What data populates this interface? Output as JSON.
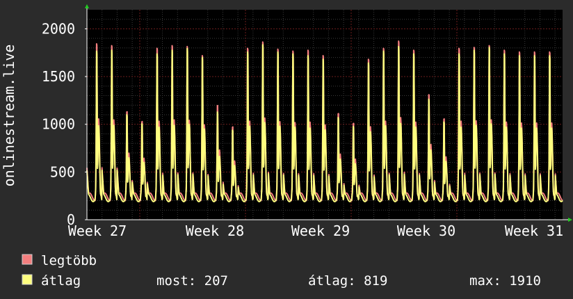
{
  "chart_data": {
    "type": "line",
    "ylabel": "onlinestream.live",
    "ylim": [
      0,
      2200
    ],
    "y_ticks": [
      "0",
      "500",
      "1000",
      "1500",
      "2000"
    ],
    "y_tick_values": [
      0,
      500,
      1000,
      1500,
      2000
    ],
    "x_ticks": [
      "Week 27",
      "Week 28",
      "Week 29",
      "Week 30",
      "Week 31"
    ],
    "x_range_days": 31.5,
    "x_tick_days": [
      0,
      7,
      14,
      21,
      28
    ],
    "grid": true,
    "colors": {
      "background": "#2b2b2b",
      "plot": "#000000",
      "grid_minor": "#3a3a3a",
      "grid_major": "#6b1d1d",
      "axis": "#ffffff",
      "arrow": "#22cc22"
    },
    "series": [
      {
        "name": "legtöbb",
        "color": "#f47f7f",
        "daily_peaks": [
          1930,
          1910,
          1180,
          1070,
          1880,
          1910,
          1900,
          1800,
          1250,
          1010,
          1880,
          1950,
          1870,
          1850,
          1860,
          1800,
          1160,
          1050,
          1760,
          1880,
          1960,
          1860,
          1370,
          1100,
          1880,
          1890,
          1910,
          1860,
          1840
        ],
        "trough": 240
      },
      {
        "name": "átlag",
        "color": "#fefe7f",
        "daily_peaks": [
          1830,
          1840,
          1130,
          1030,
          1800,
          1840,
          1860,
          1760,
          1160,
          960,
          1820,
          1900,
          1820,
          1800,
          1780,
          1740,
          1100,
          1000,
          1700,
          1830,
          1880,
          1800,
          1300,
          1050,
          1800,
          1840,
          1870,
          1800,
          1780
        ],
        "trough": 230
      }
    ],
    "legend": {
      "max_label": "legtöbb",
      "avg_label": "átlag",
      "colors": {
        "max": "#f47f7f",
        "avg": "#fefe7f"
      }
    },
    "stats": {
      "most": "most: 207",
      "avg": "átlag: 819",
      "max": "max: 1910"
    }
  }
}
